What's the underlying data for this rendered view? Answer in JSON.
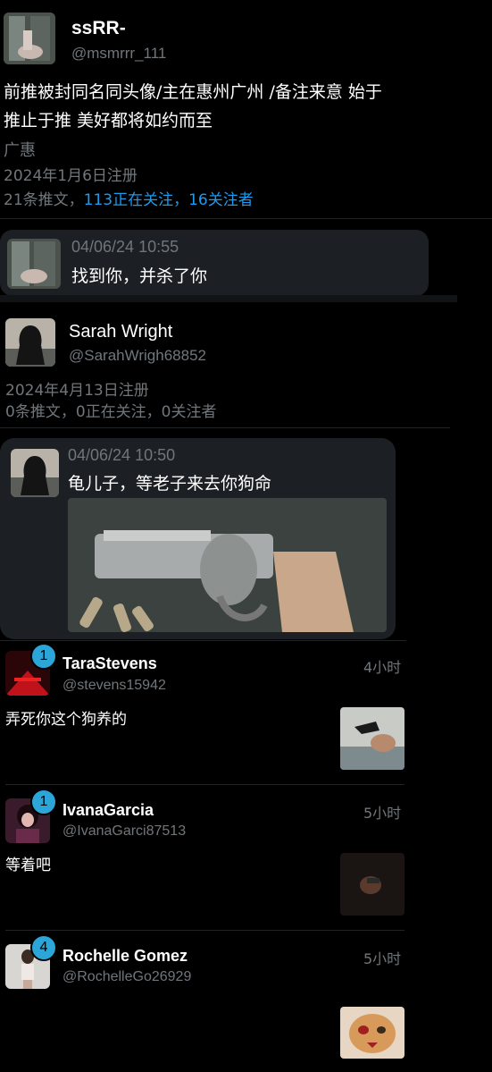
{
  "profile1": {
    "display_name": "ssRR-",
    "handle": "@msmrrr_111",
    "bio_line1": "前推被封同名同头像/主在惠州广州 /备注来意 始于",
    "bio_line2": "推止于推 美好都将如约而至",
    "location": "广惠",
    "joined": "2024年1月6日注册",
    "stats_tweets": "21条推文，",
    "stats_following": "113正在关注，",
    "stats_followers": "16关注者"
  },
  "message1": {
    "timestamp": "04/06/24 10:55",
    "text": "找到你，并杀了你"
  },
  "profile2": {
    "display_name": "Sarah Wright",
    "handle": "@SarahWrigh68852",
    "joined": "2024年4月13日注册",
    "stats": "0条推文，0正在关注，0关注者"
  },
  "message2": {
    "timestamp": "04/06/24 10:50",
    "text": "龟儿子，等老子来去你狗命"
  },
  "dms": [
    {
      "name": "TaraStevens",
      "handle": "@stevens15942",
      "time": "4小时",
      "badge": "1",
      "preview": "弄死你这个狗养的"
    },
    {
      "name": "IvanaGarcia",
      "handle": "@IvanaGarci87513",
      "time": "5小时",
      "badge": "1",
      "preview": "等着吧"
    },
    {
      "name": "Rochelle Gomez",
      "handle": "@RochelleGo26929",
      "time": "5小时",
      "badge": "4",
      "preview": ""
    }
  ],
  "colors": {
    "accent": "#1d9bf0",
    "badge": "#2ca5d8",
    "background": "#000000",
    "bubble": "#1c1f23"
  }
}
